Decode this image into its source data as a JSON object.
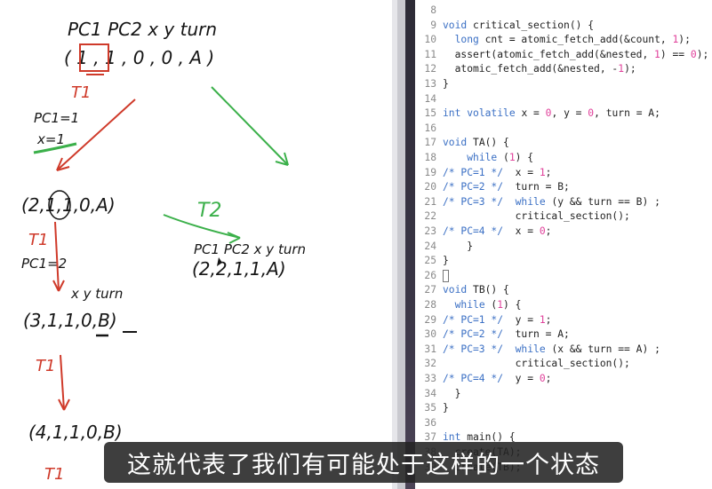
{
  "whiteboard": {
    "top_header": "PC1  PC2  x   y  turn",
    "state1": "( 1 , 1 , 0 , 0 , A )",
    "t1_label_a": "T1",
    "note_pc": "PC1=1",
    "note_x": "x=1",
    "t2_label": "T2",
    "state2": "(2,1,1,0,A)",
    "t1_label_b": "T1",
    "note_pc2": "PC1=2",
    "header2": "x y turn",
    "state3": "(3,1,1,0,B)",
    "t1_label_c": "T1",
    "state4": "(4,1,1,0,B)",
    "t1_label_d": "T1",
    "right_header": "PC1 PC2 x y turn",
    "right_state": "(2,2,1,1,A)"
  },
  "editor": {
    "lines": [
      {
        "n": "8",
        "t": ""
      },
      {
        "n": "9",
        "t": "void critical_section() {"
      },
      {
        "n": "10",
        "t": "  long cnt = atomic_fetch_add(&count, 1);"
      },
      {
        "n": "11",
        "t": "  assert(atomic_fetch_add(&nested, 1) == 0);"
      },
      {
        "n": "12",
        "t": "  atomic_fetch_add(&nested, -1);"
      },
      {
        "n": "13",
        "t": "}"
      },
      {
        "n": "14",
        "t": ""
      },
      {
        "n": "15",
        "t": "int volatile x = 0, y = 0, turn = A;"
      },
      {
        "n": "16",
        "t": ""
      },
      {
        "n": "17",
        "t": "void TA() {"
      },
      {
        "n": "18",
        "t": "    while (1) {"
      },
      {
        "n": "19",
        "t": "/* PC=1 */  x = 1;"
      },
      {
        "n": "20",
        "t": "/* PC=2 */  turn = B;"
      },
      {
        "n": "21",
        "t": "/* PC=3 */  while (y && turn == B) ;"
      },
      {
        "n": "22",
        "t": "            critical_section();"
      },
      {
        "n": "23",
        "t": "/* PC=4 */  x = 0;"
      },
      {
        "n": "24",
        "t": "    }"
      },
      {
        "n": "25",
        "t": "}"
      },
      {
        "n": "26",
        "t": ""
      },
      {
        "n": "27",
        "t": "void TB() {"
      },
      {
        "n": "28",
        "t": "  while (1) {"
      },
      {
        "n": "29",
        "t": "/* PC=1 */  y = 1;"
      },
      {
        "n": "30",
        "t": "/* PC=2 */  turn = A;"
      },
      {
        "n": "31",
        "t": "/* PC=3 */  while (x && turn == A) ;"
      },
      {
        "n": "32",
        "t": "            critical_section();"
      },
      {
        "n": "33",
        "t": "/* PC=4 */  y = 0;"
      },
      {
        "n": "34",
        "t": "  }"
      },
      {
        "n": "35",
        "t": "}"
      },
      {
        "n": "36",
        "t": ""
      },
      {
        "n": "37",
        "t": "int main() {"
      },
      {
        "n": "38",
        "t": "  create(TA);"
      },
      {
        "n": "39",
        "t": "  create(TB);"
      }
    ]
  },
  "subtitle": "这就代表了我们有可能处于这样的一个状态",
  "colors": {
    "ink": "#151515",
    "red_pen": "#cf3a2a",
    "green_pen": "#3bb04a",
    "keyword": "#3a6fc4",
    "number": "#e0409a"
  }
}
